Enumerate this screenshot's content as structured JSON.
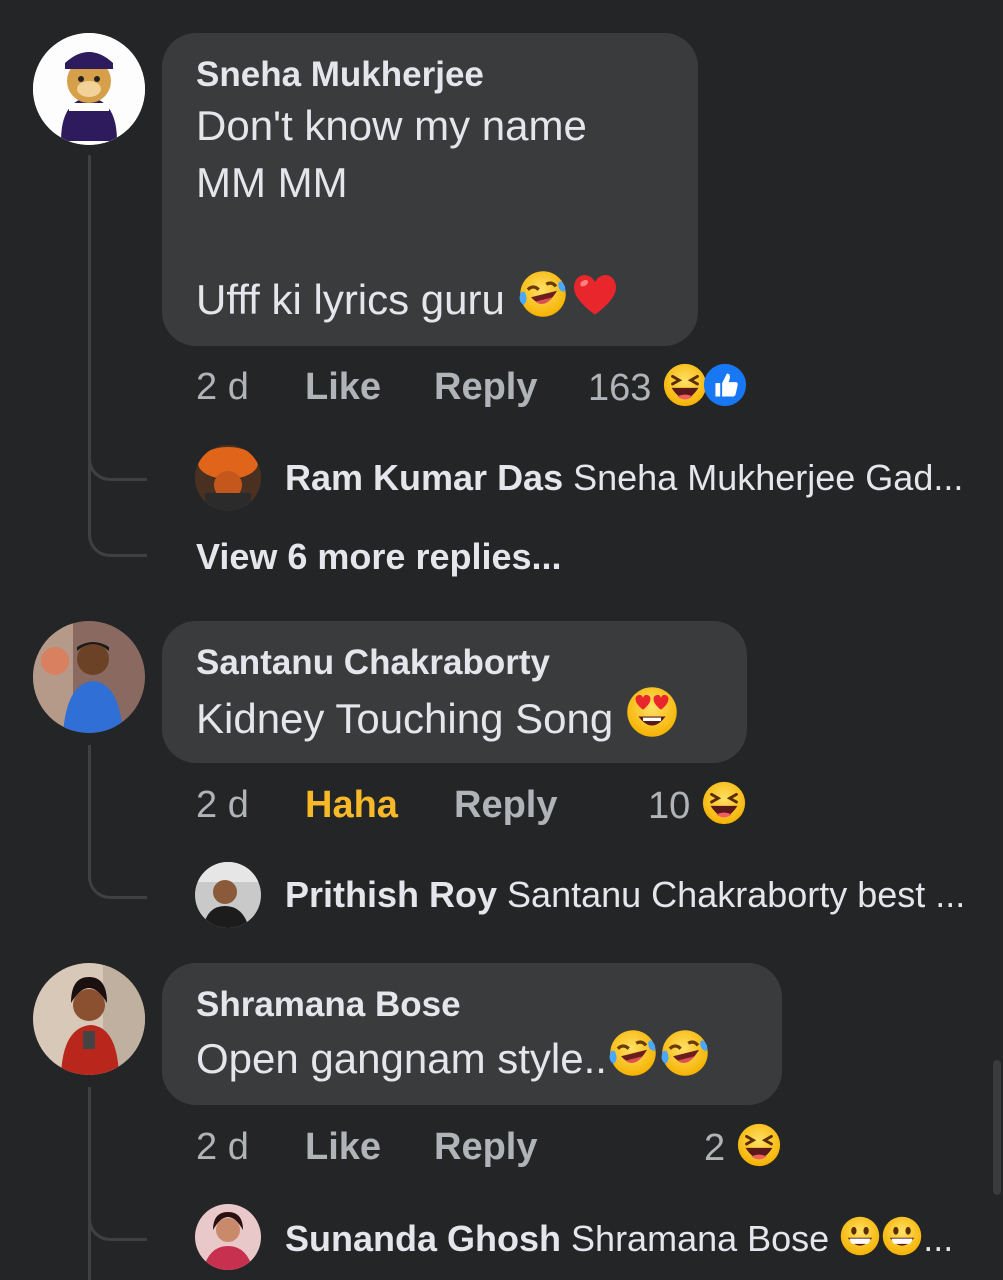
{
  "comments": [
    {
      "author": "Sneha Mukherjee",
      "lines": [
        "Don't know my name",
        "MM MM",
        "",
        "Ufff ki lyrics guru"
      ],
      "time": "2 d",
      "action": "Like",
      "reply": "Reply",
      "reaction_count": "163",
      "reply_preview": {
        "author": "Ram Kumar Das",
        "text": "Sneha Mukherjee Gad..."
      },
      "view_more": "View 6 more replies..."
    },
    {
      "author": "Santanu Chakraborty",
      "lines": [
        "Kidney Touching Song"
      ],
      "time": "2 d",
      "action": "Haha",
      "reply": "Reply",
      "reaction_count": "10",
      "reply_preview": {
        "author": "Prithish Roy",
        "text": "Santanu Chakraborty best ..."
      }
    },
    {
      "author": "Shramana Bose",
      "lines": [
        "Open gangnam style.."
      ],
      "time": "2 d",
      "action": "Like",
      "reply": "Reply",
      "reaction_count": "2",
      "reply_preview": {
        "author": "Sunanda Ghosh",
        "text": "Shramana Bose"
      }
    }
  ],
  "colors": {
    "background": "#242526",
    "bubble": "#3a3b3c",
    "text": "#e4e6eb",
    "secondary": "#b0b3b8",
    "haha_active": "#f7b928",
    "like_blue": "#1877f2"
  }
}
